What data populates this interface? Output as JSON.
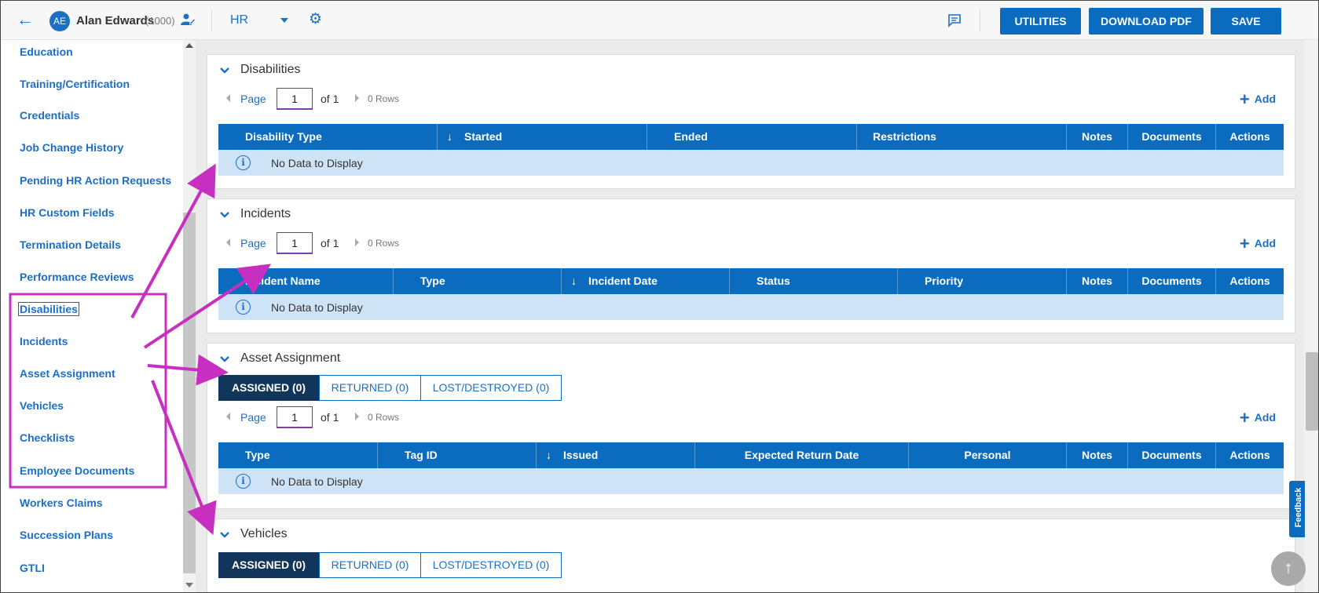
{
  "header": {
    "back_icon": "arrow-left-icon",
    "avatar_initials": "AE",
    "user_name": "Alan Edwards",
    "user_id": "(1000)",
    "module": "HR",
    "buttons": {
      "utilities": "UTILITIES",
      "download_pdf": "DOWNLOAD PDF",
      "save": "SAVE"
    }
  },
  "sidebar": {
    "items": [
      {
        "label": "Education"
      },
      {
        "label": "Training/Certification"
      },
      {
        "label": "Credentials"
      },
      {
        "label": "Job Change History"
      },
      {
        "label": "Pending HR Action Requests"
      },
      {
        "label": "HR Custom Fields"
      },
      {
        "label": "Termination Details"
      },
      {
        "label": "Performance Reviews"
      },
      {
        "label": "Disabilities"
      },
      {
        "label": "Incidents"
      },
      {
        "label": "Asset Assignment"
      },
      {
        "label": "Vehicles"
      },
      {
        "label": "Checklists"
      },
      {
        "label": "Employee Documents"
      },
      {
        "label": "Workers Claims"
      },
      {
        "label": "Succession Plans"
      },
      {
        "label": "GTLI"
      }
    ]
  },
  "pager": {
    "page_label": "Page",
    "page_value": "1",
    "of_label": "of 1",
    "rows_label": "0 Rows"
  },
  "add_label": "Add",
  "no_data": "No Data to Display",
  "sections": {
    "disabilities": {
      "title": "Disabilities",
      "columns": [
        "Disability Type",
        "Started",
        "Ended",
        "Restrictions",
        "Notes",
        "Documents",
        "Actions"
      ]
    },
    "incidents": {
      "title": "Incidents",
      "columns": [
        "Incident Name",
        "Type",
        "Incident Date",
        "Status",
        "Priority",
        "Notes",
        "Documents",
        "Actions"
      ]
    },
    "asset_assignment": {
      "title": "Asset Assignment",
      "tabs": [
        "ASSIGNED (0)",
        "RETURNED (0)",
        "LOST/DESTROYED (0)"
      ],
      "columns": [
        "Type",
        "Tag ID",
        "Issued",
        "Expected Return Date",
        "Personal",
        "Notes",
        "Documents",
        "Actions"
      ]
    },
    "vehicles": {
      "title": "Vehicles",
      "tabs": [
        "ASSIGNED (0)",
        "RETURNED (0)",
        "LOST/DESTROYED (0)"
      ]
    }
  },
  "feedback_label": "Feedback",
  "colors": {
    "primary": "#0b6cbf",
    "active_tab": "#12355b",
    "annotation": "#c62fc0",
    "no_data_row": "#cfe3f7"
  }
}
